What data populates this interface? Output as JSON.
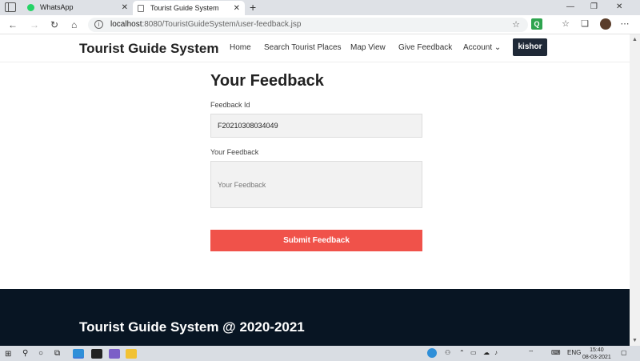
{
  "browser": {
    "tabs": [
      {
        "title": "WhatsApp",
        "close": "✕"
      },
      {
        "title": "Tourist Guide System",
        "close": "✕"
      }
    ],
    "new_tab": "+",
    "window_controls": {
      "minimize": "—",
      "restore": "❐",
      "close": "✕"
    },
    "nav": {
      "back": "←",
      "forward": "→",
      "reload": "↻",
      "home": "⌂"
    },
    "url": {
      "host": "localhost",
      "path": ":8080/TouristGuideSystem/user-feedback.jsp"
    },
    "extension_label": "Q"
  },
  "site": {
    "brand": "Tourist Guide System",
    "nav": [
      {
        "label": "Home"
      },
      {
        "label": "Search Tourist Places"
      },
      {
        "label": "Map View"
      },
      {
        "label": "Give Feedback"
      },
      {
        "label": "Account ⌄"
      }
    ],
    "user_name": "kishor"
  },
  "form": {
    "title": "Your Feedback",
    "id_label": "Feedback Id",
    "id_value": "F20210308034049",
    "feedback_label": "Your Feedback",
    "feedback_placeholder": "Your Feedback",
    "submit_label": "Submit Feedback"
  },
  "footer": {
    "text": "Tourist Guide System @ 2020-2021"
  },
  "taskbar": {
    "language": "ENG",
    "time": "15:40",
    "date": "08-03-2021"
  },
  "colors": {
    "accent": "#f0524a",
    "footer_bg": "#081523",
    "user_button": "#1f2937"
  }
}
